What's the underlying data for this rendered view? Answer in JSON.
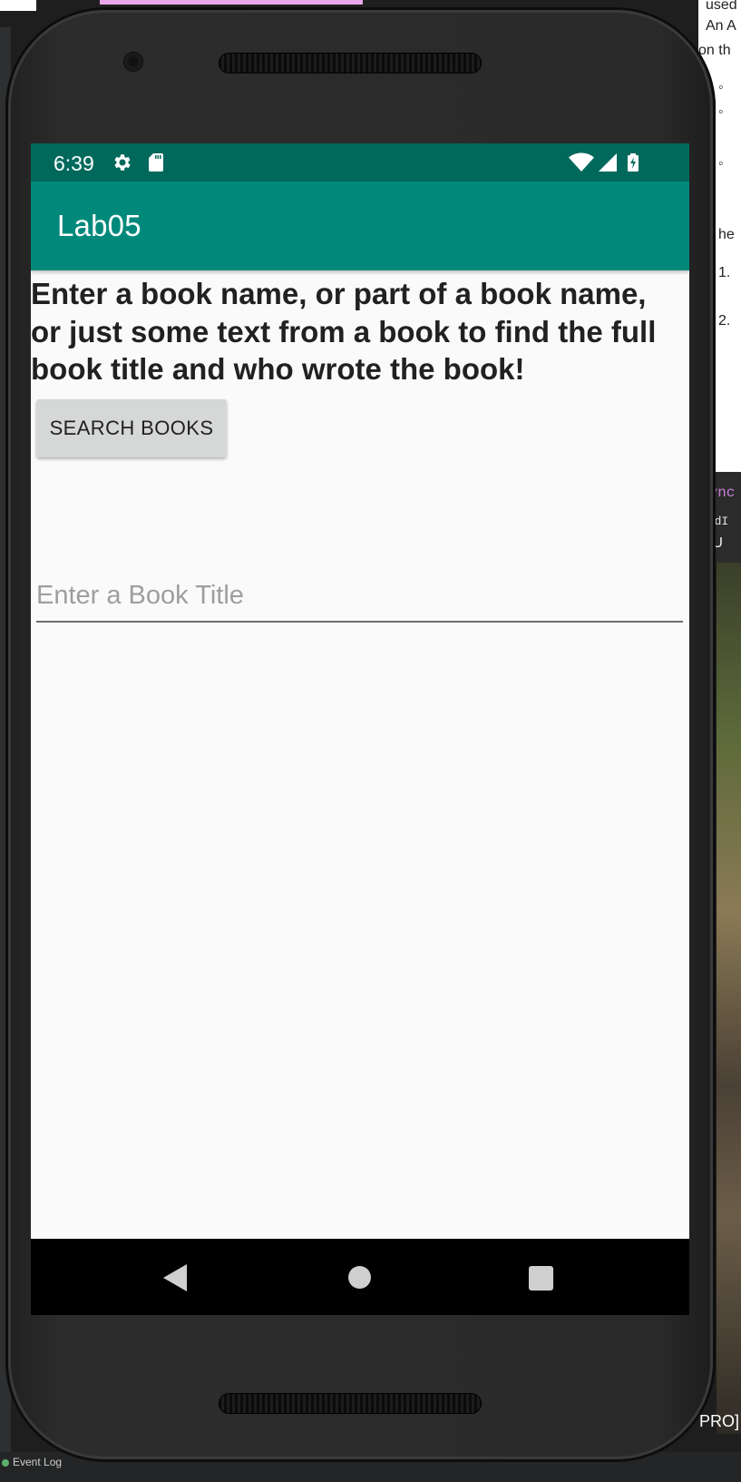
{
  "status_bar": {
    "time": "6:39",
    "icons": [
      "settings-icon",
      "sd-card-icon",
      "wifi-icon",
      "signal-icon",
      "battery-charging-icon"
    ]
  },
  "app_bar": {
    "title": "Lab05"
  },
  "content": {
    "instructions": "Enter a book name, or part of a book name, or just some text from a book to find the full book title and who wrote the book!",
    "search_button_label": "SEARCH BOOKS",
    "book_input": {
      "placeholder": "Enter a Book Title",
      "value": ""
    }
  },
  "nav_bar": {
    "buttons": [
      "back-icon",
      "home-icon",
      "recents-icon"
    ]
  },
  "background": {
    "doc_lines": [
      "used",
      "An A",
      "on th",
      "◦",
      "◦",
      "◦",
      "he",
      "1.",
      "2."
    ],
    "code_keyword": "sync",
    "code_line": "oadI",
    "code_text": "e U",
    "bottom_right_text": "PRO]",
    "event_log_label": "Event Log"
  },
  "colors": {
    "status_bar": "#00695c",
    "app_bar": "#00897b",
    "screen_background": "#fafafa",
    "button_background": "#d6d7d7"
  }
}
